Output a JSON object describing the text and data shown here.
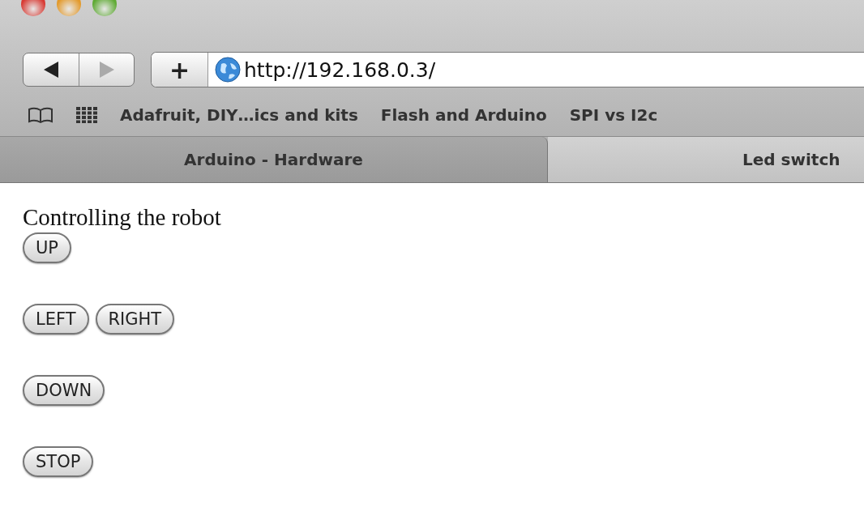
{
  "toolbar": {
    "back_disabled": false,
    "forward_disabled": true,
    "add_label": "+",
    "address": "http://192.168.0.3/"
  },
  "bookmarks": [
    "Adafruit, DIY…ics and kits",
    "Flash and Arduino",
    "SPI vs I2c"
  ],
  "tabs": [
    {
      "label": "Arduino - Hardware",
      "selected": false
    },
    {
      "label": "Led switch",
      "selected": true
    }
  ],
  "page": {
    "heading": "Controlling the robot",
    "button_rows": [
      [
        "UP"
      ],
      [
        "LEFT",
        "RIGHT"
      ],
      [
        "DOWN"
      ],
      [
        "STOP"
      ]
    ]
  }
}
